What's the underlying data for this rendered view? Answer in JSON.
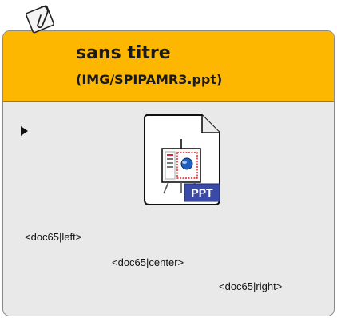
{
  "document": {
    "title": "sans titre",
    "subtitle": "(IMG/SPIPAMR3.ppt)",
    "file_type_label": "PPT",
    "icon": "powerpoint-file-icon",
    "attachment_icon": "paperclip-icon",
    "expand_icon": "disclosure-triangle-icon"
  },
  "doc_tags": {
    "left": "<doc65|left>",
    "center": "<doc65|center>",
    "right": "<doc65|right>"
  },
  "colors": {
    "header": "#fdb700",
    "body": "#e9e9e9",
    "ppt_badge": "#3a4aa6"
  }
}
